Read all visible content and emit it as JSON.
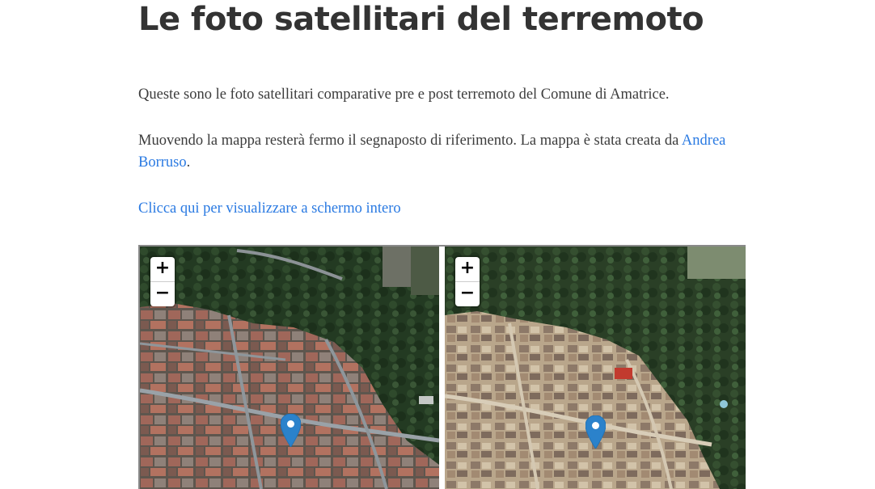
{
  "article": {
    "title": "Le foto satellitari del terremoto",
    "para1": "Queste sono le foto satellitari comparative pre e post terremoto del Comune di Amatrice.",
    "para2_before": "Muovendo la mappa resterà fermo il segnaposto di riferimento. La mappa è stata creata da ",
    "para2_link": "Andrea Borruso",
    "para2_after": ".",
    "fullscreen_link": "Clicca qui per visualizzare a schermo intero"
  },
  "maps": {
    "left": {
      "zoom_in": "+",
      "zoom_out": "−",
      "marker_icon": "map-marker-icon"
    },
    "right": {
      "zoom_in": "+",
      "zoom_out": "−",
      "marker_icon": "map-marker-icon"
    }
  },
  "colors": {
    "link": "#2a7ae2",
    "marker": "#2b82cb",
    "text": "#333333"
  }
}
